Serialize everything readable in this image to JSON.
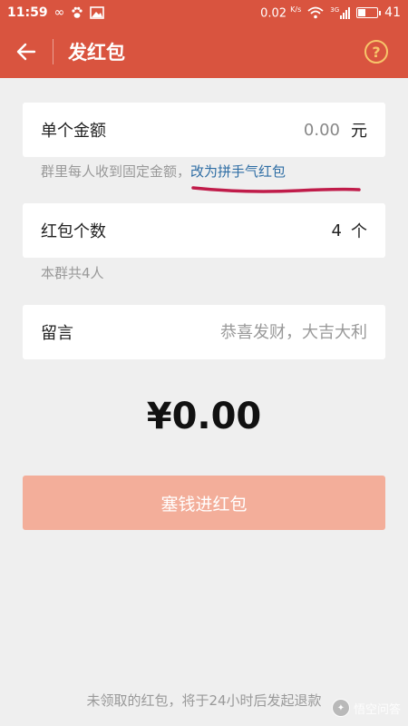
{
  "status_bar": {
    "time": "11:59",
    "infinity_glyph": "∞",
    "speed": "0.02",
    "speed_unit": "K/s",
    "network": "3G",
    "battery": "41",
    "battery_level": 0.41
  },
  "header": {
    "title": "发红包",
    "help_glyph": "?"
  },
  "amount": {
    "label": "单个金额",
    "value": "0.00",
    "unit": "元"
  },
  "amount_hint": {
    "text": "群里每人收到固定金额，",
    "link": "改为拼手气红包"
  },
  "count": {
    "label": "红包个数",
    "value": "4",
    "unit": "个"
  },
  "count_hint": "本群共4人",
  "message": {
    "label": "留言",
    "placeholder": "恭喜发财，大吉大利"
  },
  "total": "¥0.00",
  "submit_label": "塞钱进红包",
  "footer_note": "未领取的红包，将于24小时后发起退款",
  "watermark": "悟空问答",
  "colors": {
    "header_bg": "#d9543f",
    "submit_bg": "#f3ae9a",
    "link": "#2e6da4",
    "annotation": "#c01c4a"
  }
}
